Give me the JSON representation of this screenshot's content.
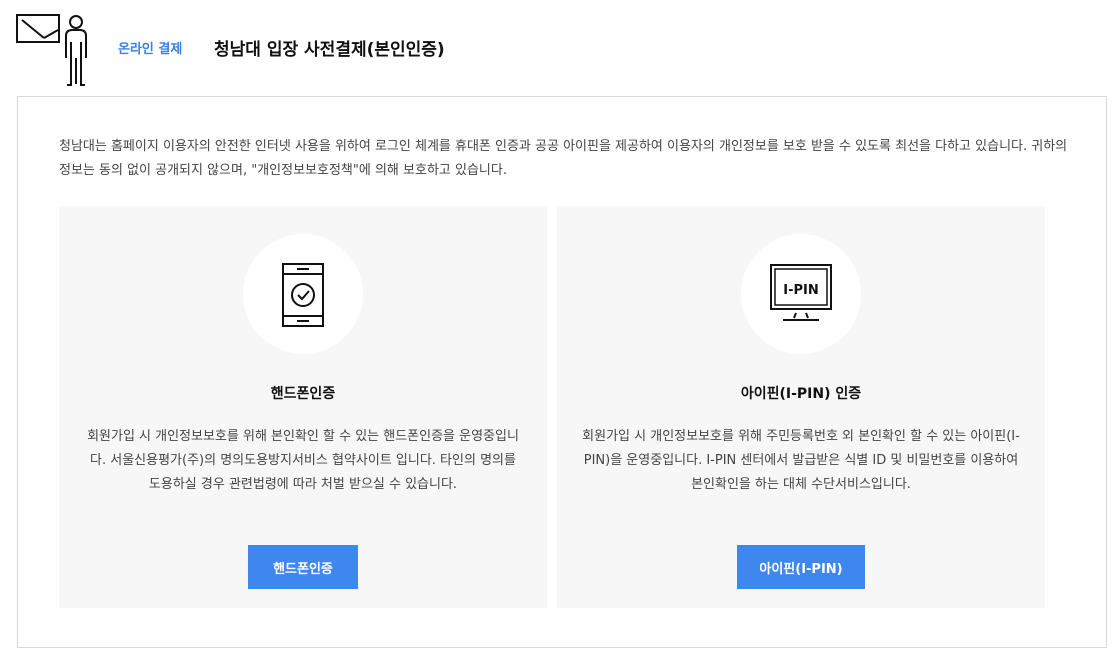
{
  "header": {
    "subtitle": "온라인 결제",
    "title": "청남대 입장 사전결제(본인인증)"
  },
  "intro": "청남대는 홈페이지 이용자의 안전한 인터넷 사용을 위하여 로그인 체계를 휴대폰 인증과 공공 아이핀을 제공하여 이용자의 개인정보를 보호 받을 수 있도록 최선을 다하고 있습니다. 귀하의 정보는 동의 없이 공개되지 않으며, \"개인정보보호정책\"에 의해 보호하고 있습니다.",
  "cards": [
    {
      "title": "핸드폰인증",
      "description": "회원가입 시 개인정보보호를 위해 본인확인 할 수 있는 핸드폰인증을 운영중입니다. 서울신용평가(주)의 명의도용방지서비스 협약사이트 입니다. 타인의 명의를 도용하실 경우 관련법령에 따라 처벌 받으실 수 있습니다.",
      "button": "핸드폰인증",
      "icon": "phone-check-icon"
    },
    {
      "title": "아이핀(I-PIN) 인증",
      "description": "회원가입 시 개인정보보호를 위해 주민등록번호 외 본인확인 할 수 있는 아이핀(I-PIN)을 운영중입니다. I-PIN 센터에서 발급받은 식별 ID 및 비밀번호를 이용하여 본인확인을 하는 대체 수단서비스입니다.",
      "button": "아이핀(I-PIN)",
      "icon": "ipin-monitor-icon",
      "icon_text": "I-PIN"
    }
  ],
  "colors": {
    "accent": "#3a7fe6",
    "button": "#3f86ee",
    "card_bg": "#f7f7f7"
  }
}
